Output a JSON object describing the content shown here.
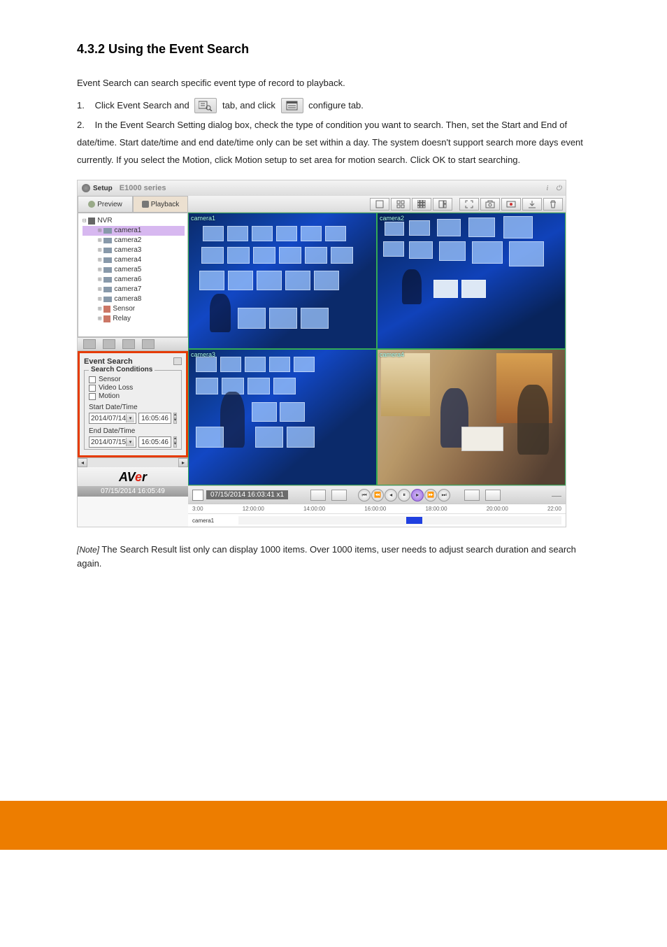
{
  "doc": {
    "section_title": "4.3.2 Using the Event Search",
    "intro": "Event Search can search specific event type of record to playback.",
    "step1": "Click Event Search and",
    "step2": "In the Event Search Setting dialog box, check the type of condition you want to search. Then, set the Start and End of date/time. Start date/time and end date/time only can be set within a day. The system doesn't support search more days event currently. If you select the Motion, click Motion setup to set area for motion search. Click OK to start searching.",
    "step1_n": "1.",
    "step2_n": "2.",
    "note_label": "[Note]",
    "note_text": "The Search Result list only can display 1000 items. Over 1000 items, user needs to adjust search duration and search again.",
    "btn1_label": "Event Search",
    "btn2_label": "configure tab"
  },
  "app": {
    "setup": "Setup",
    "series": "E1000 series",
    "tabs": {
      "preview": "Preview",
      "playback": "Playback"
    },
    "tree": {
      "root": "NVR",
      "cams": [
        "camera1",
        "camera2",
        "camera3",
        "camera4",
        "camera5",
        "camera6",
        "camera7",
        "camera8"
      ],
      "sensor": "Sensor",
      "relay": "Relay"
    },
    "event_search": {
      "title": "Event Search",
      "legend": "Search Conditions",
      "cond": {
        "sensor": "Sensor",
        "videoloss": "Video Loss",
        "motion": "Motion"
      },
      "start_label": "Start Date/Time",
      "start_date": "2014/07/14",
      "start_time": "16:05:46",
      "end_label": "End Date/Time",
      "end_date": "2014/07/15",
      "end_time": "16:05:46"
    },
    "brand": {
      "a": "AV",
      "e": "e",
      "r": "r"
    },
    "datetime": "07/15/2014 16:05:49",
    "camlabels": {
      "c1": "camera1",
      "c2": "camera2",
      "c3": "camera3",
      "c4": "camera4"
    },
    "playback": {
      "time": "07/15/2014 16:03:41 x1",
      "ticks": [
        "3:00",
        "12:00:00",
        "14:00:00",
        "16:00:00",
        "18:00:00",
        "20:00:00",
        "22:00"
      ],
      "row_label": "camera1"
    }
  }
}
